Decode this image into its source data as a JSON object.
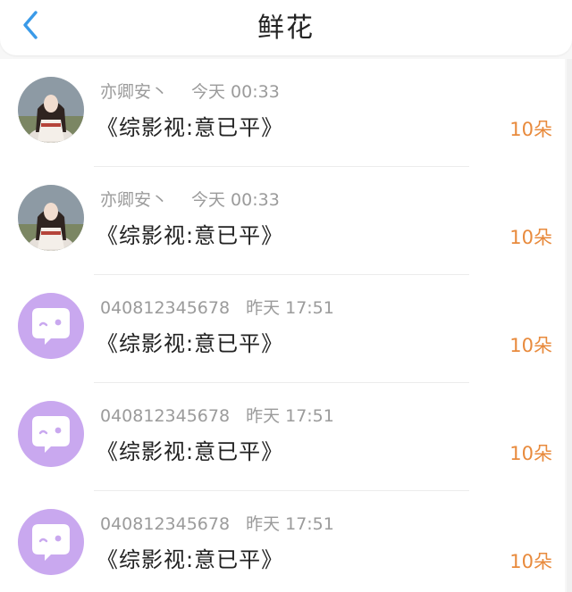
{
  "header": {
    "title": "鲜花"
  },
  "icons": {
    "back": "chevron-left-icon",
    "default_avatar": "chat-bubble-icon"
  },
  "colors": {
    "accent_blue": "#3a9ae8",
    "amount_orange": "#e88a3c",
    "avatar_purple": "#c9a8ef",
    "meta_gray": "#9b9b9b"
  },
  "items": [
    {
      "user": "亦卿安丶",
      "time": "今天 00:33",
      "book": "《综影视:意已平》",
      "amount": "10朵",
      "avatar": "photo"
    },
    {
      "user": "亦卿安丶",
      "time": "今天 00:33",
      "book": "《综影视:意已平》",
      "amount": "10朵",
      "avatar": "photo"
    },
    {
      "user": "040812345678",
      "time": "昨天 17:51",
      "book": "《综影视:意已平》",
      "amount": "10朵",
      "avatar": "default"
    },
    {
      "user": "040812345678",
      "time": "昨天 17:51",
      "book": "《综影视:意已平》",
      "amount": "10朵",
      "avatar": "default"
    },
    {
      "user": "040812345678",
      "time": "昨天 17:51",
      "book": "《综影视:意已平》",
      "amount": "10朵",
      "avatar": "default"
    }
  ]
}
